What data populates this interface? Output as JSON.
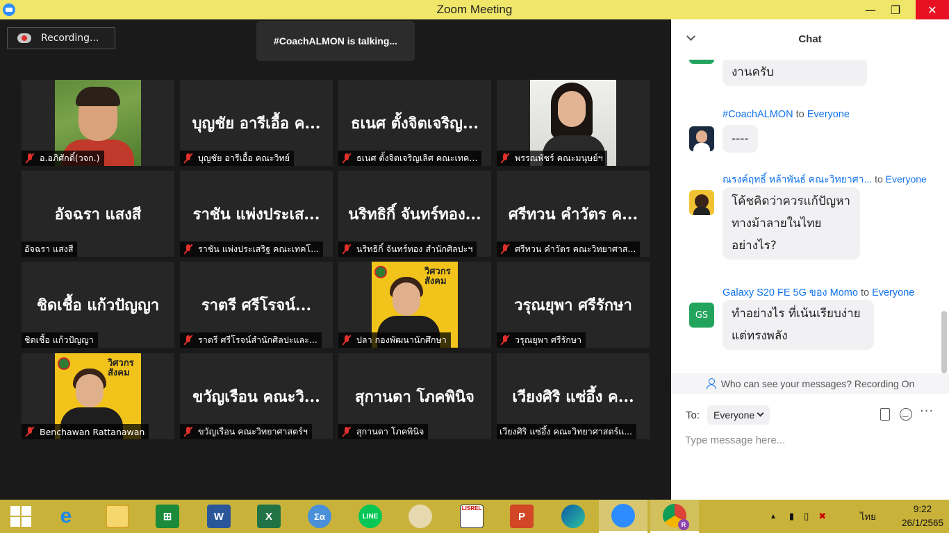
{
  "window": {
    "title": "Zoom Meeting",
    "minimize": "—",
    "maximize": "❐",
    "close": "✕"
  },
  "recording": {
    "label": "Recording..."
  },
  "talking": {
    "text": "#CoachALMON is talking..."
  },
  "tiles": [
    {
      "name": "อ.อภิศักดิ์(วจก.)",
      "big": "",
      "muted": true,
      "photo": "green"
    },
    {
      "name": "บุญชัย อารีเอื้อ คณะวิทย์",
      "big": "บุญชัย อารีเอื้อ ค...",
      "muted": true
    },
    {
      "name": "ธเนศ ตั้งจิตเจริญเลิศ คณะเทค...",
      "big": "ธเนศ ตั้งจิตเจริญ...",
      "muted": true
    },
    {
      "name": "พรรณพัชร์ คณะมนุษย์ฯ",
      "big": "",
      "muted": true,
      "photo": "white"
    },
    {
      "name": "อัจฉรา แสงสี",
      "big": "อัจฉรา แสงสี",
      "muted": false
    },
    {
      "name": "ราชัน แพ่งประเสริฐ คณะเทคโ...",
      "big": "ราชัน แพ่งประเส...",
      "muted": true
    },
    {
      "name": "นริทธิกิ์ จันทร์ทอง สำนักศิลปะฯ",
      "big": "นริทธิกิ์ จันทร์ทอง...",
      "muted": true
    },
    {
      "name": "ศรีทวน  คำวัตร คณะวิทยาศาส...",
      "big": "ศรีทวน  คำวัตร ค...",
      "muted": true
    },
    {
      "name": "ชิดเชื้อ แก้วปัญญา",
      "big": "ชิดเชื้อ แก้วปัญญา",
      "muted": false
    },
    {
      "name": "ราตรี   ศรีโรจน์สำนักศิลปะและ...",
      "big": "ราตรี   ศรีโรจน์...",
      "muted": true
    },
    {
      "name": "ปลา กองพัฒนานักศึกษา",
      "big": "",
      "muted": true,
      "photo": "yellow"
    },
    {
      "name": "วรุณยุพา ศรีรักษา",
      "big": "วรุณยุพา ศรีรักษา",
      "muted": true
    },
    {
      "name": "Benchawan Rattanawan",
      "big": "",
      "muted": true,
      "photo": "yellow2"
    },
    {
      "name": "ขวัญเรือน คณะวิทยาศาสตร์ฯ",
      "big": "ขวัญเรือน คณะวิ...",
      "muted": true
    },
    {
      "name": "สุกานดา โภคพินิจ",
      "big": "สุกานดา โภคพินิจ",
      "muted": true
    },
    {
      "name": "เวียงศิริ  แซ่อึ้ง  คณะวิทยาศาสตร์แ...",
      "big": "เวียงศิริ  แซ่อึ้ง  ค...",
      "muted": false
    }
  ],
  "badge_text": "วิศวกรสังคม",
  "chat": {
    "title": "Chat",
    "messages": [
      {
        "sender": "",
        "to": "",
        "text": "งานครับ"
      },
      {
        "sender": "#CoachALMON",
        "to": "to",
        "recipient": "Everyone",
        "text": "----"
      },
      {
        "sender": "ณรงค์ฤทธิ์ หล้าพันธ์ คณะวิทยาศา...",
        "to": "to",
        "recipient": "Everyone",
        "text": "โค้ชคิดว่าควรแก้ปัญหาทางม้าลายในไทยอย่างไร?"
      },
      {
        "sender": "Galaxy S20 FE 5G ของ Momo",
        "to": "to",
        "recipient": "Everyone",
        "text": "ทำอย่างไร ที่เน้นเรียบง่ายแต่ทรงพลัง",
        "initials": "GS"
      }
    ],
    "privacy": "Who can see your messages? Recording On",
    "to_label": "To:",
    "recipient": "Everyone",
    "placeholder": "Type message here...",
    "more": "···"
  },
  "taskbar": {
    "apps": [
      "start",
      "internet-explorer",
      "file-explorer",
      "store",
      "word",
      "excel",
      "math",
      "line",
      "paint",
      "lisrel",
      "powerpoint",
      "edge",
      "zoom",
      "chrome"
    ],
    "labels": {
      "word": "W",
      "excel": "X",
      "powerpoint": "P",
      "line": "LINE",
      "math": "Σα",
      "lisrel": "LISREL",
      "chrome_badge": "R"
    },
    "lang": "ไทย",
    "time": "9:22",
    "date": "26/1/2565"
  }
}
